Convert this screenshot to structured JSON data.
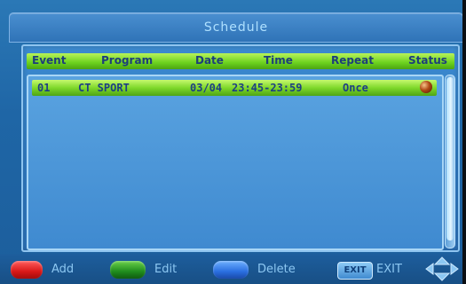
{
  "window": {
    "title": "Schedule"
  },
  "table": {
    "headers": [
      "Event",
      "Program",
      "Date",
      "Time",
      "Repeat",
      "Status"
    ],
    "rows": [
      {
        "event": "01",
        "program": "CT SPORT",
        "date": "03/04",
        "time": "23:45-23:59",
        "repeat": "Once",
        "status_icon": "recording-status-icon"
      }
    ]
  },
  "footer": {
    "add_label": "Add",
    "edit_label": "Edit",
    "delete_label": "Delete",
    "exit_key": "EXIT",
    "exit_label": "EXIT"
  },
  "colors": {
    "add": "#d81818",
    "edit": "#1f8c1d",
    "delete": "#2a6fe0",
    "highlight": "#7fd82a"
  }
}
